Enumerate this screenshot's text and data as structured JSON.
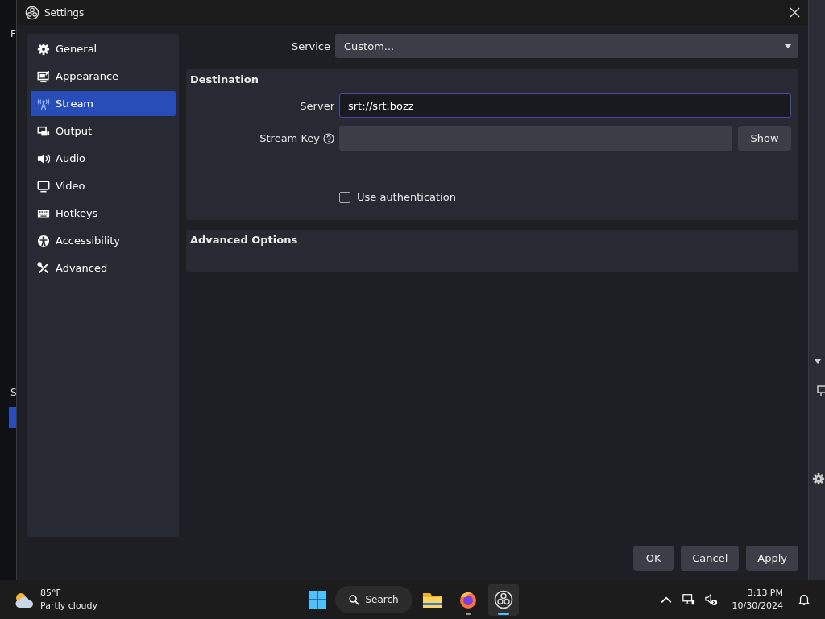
{
  "background_window": {
    "texts": [
      "F",
      "S"
    ]
  },
  "window": {
    "title": "Settings"
  },
  "sidebar": {
    "items": [
      {
        "label": "General",
        "kind": "gear",
        "selected": false
      },
      {
        "label": "Appearance",
        "kind": "appearance",
        "selected": false
      },
      {
        "label": "Stream",
        "kind": "antenna",
        "selected": true
      },
      {
        "label": "Output",
        "kind": "output",
        "selected": false
      },
      {
        "label": "Audio",
        "kind": "speaker",
        "selected": false
      },
      {
        "label": "Video",
        "kind": "monitor",
        "selected": false
      },
      {
        "label": "Hotkeys",
        "kind": "keyboard",
        "selected": false
      },
      {
        "label": "Accessibility",
        "kind": "person",
        "selected": false
      },
      {
        "label": "Advanced",
        "kind": "tools",
        "selected": false
      }
    ]
  },
  "service": {
    "label": "Service",
    "value": "Custom..."
  },
  "destination": {
    "title": "Destination",
    "server": {
      "label": "Server",
      "value": "srt://srt.bozz"
    },
    "stream_key": {
      "label": "Stream Key"
    },
    "show_button": "Show",
    "use_authentication": {
      "label": "Use authentication",
      "checked": false
    }
  },
  "advanced_options": {
    "title": "Advanced Options"
  },
  "buttons": [
    "OK",
    "Cancel",
    "Apply"
  ],
  "taskbar": {
    "weather": {
      "temperature": "85°F",
      "condition": "Partly cloudy"
    },
    "search": "Search",
    "apps": [
      {
        "kind": "files",
        "running": false,
        "active": false
      },
      {
        "kind": "firefox",
        "running": true,
        "active": false
      },
      {
        "kind": "obs",
        "running": true,
        "active": true
      }
    ],
    "time": "3:13 PM",
    "date": "10/30/2024"
  }
}
